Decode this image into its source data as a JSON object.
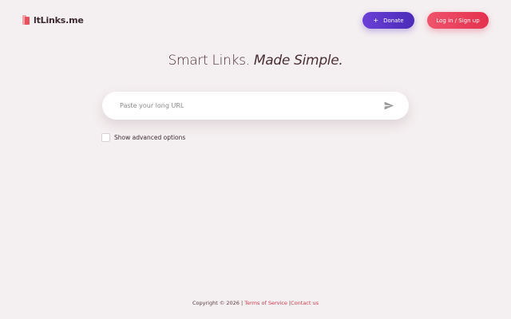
{
  "header": {
    "logo_text": "ltLinks.me",
    "donate_icon": "+",
    "donate_label": "Donate",
    "login_label": "Log in / Sign up"
  },
  "hero": {
    "title_plain": "Smart Links.",
    "title_italic": "Made Simple."
  },
  "search": {
    "placeholder": "Paste your long URL",
    "value": "",
    "submit_icon": "send-icon"
  },
  "options": {
    "advanced_label": "Show advanced options",
    "advanced_checked": false
  },
  "footer": {
    "copyright": "Copyright © 2026 |",
    "terms_label": "Terms of Service",
    "separator": "|",
    "contact_label": "Contact us"
  },
  "colors": {
    "background": "#f4eff0",
    "donate_button": "#5a35c8",
    "login_button": "#e8405d",
    "link": "#d63a50",
    "text": "#4a3035"
  }
}
